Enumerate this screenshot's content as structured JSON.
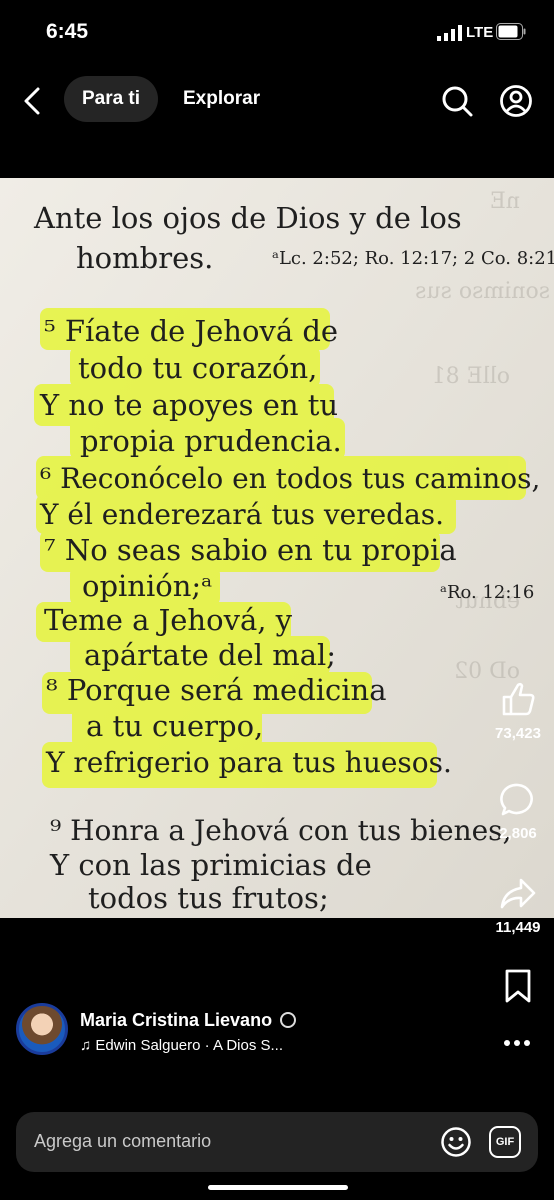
{
  "status_bar": {
    "time": "6:45",
    "network": "LTE"
  },
  "nav": {
    "tab_active": "Para ti",
    "tab_other": "Explorar"
  },
  "post": {
    "verse_lines": [
      "Ante los ojos de Dios y de los",
      "hombres.",
      "ᵃLc. 2:52; Ro. 12:17; 2 Co. 8:21",
      "⁵ Fíate de Jehová de",
      "todo tu corazón,",
      "Y no te apoyes en tu",
      "propia prudencia.",
      "⁶ Reconócelo en todos tus caminos,",
      "Y él enderezará tus veredas.",
      "⁷ No seas sabio en tu propia",
      "opinión;ᵃ",
      "ᵃRo. 12:16",
      "Teme a Jehová, y",
      "apártate del mal;",
      "⁸ Porque será medicina",
      "a tu cuerpo,",
      "Y refrigerio para tus huesos.",
      "⁹ Honra a Jehová con tus bienes,",
      "Y con las primicias de",
      "todos tus frutos;"
    ],
    "highlight_color": "#e6f53a"
  },
  "actions": {
    "likes": "73,423",
    "comments": "2,806",
    "shares": "11,449"
  },
  "author": {
    "name": "Maria Cristina Lievano",
    "music": "Edwin Salguero · A Dios S..."
  },
  "comment": {
    "placeholder": "Agrega un comentario",
    "gif_label": "GIF"
  }
}
